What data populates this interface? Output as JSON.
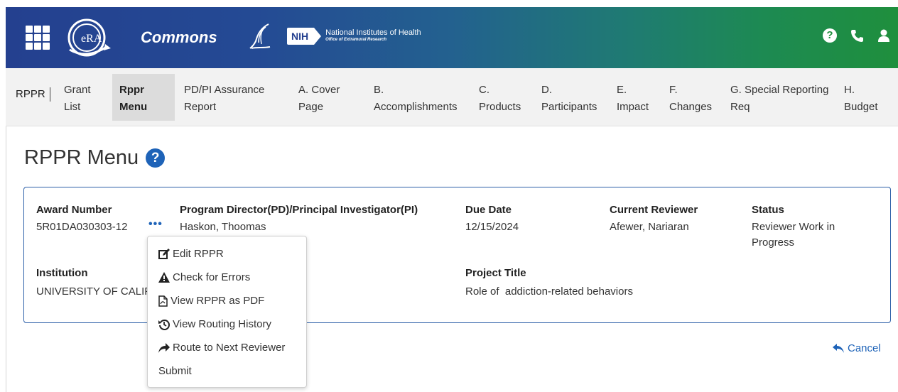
{
  "header": {
    "app_name": "Commons",
    "era_logo_text": "eRA",
    "nih_badge": "NIH",
    "nih_name": "National Institutes of Health",
    "nih_office": "Office of Extramural Research",
    "icons": [
      "apps-grid-icon",
      "help-icon",
      "phone-icon",
      "user-icon"
    ],
    "gradient_colors": [
      "#24408f",
      "#1f8f3d"
    ]
  },
  "nav": {
    "root": "RPPR",
    "items": [
      {
        "line1": "Grant",
        "line2": "List"
      },
      {
        "line1": "Rppr",
        "line2": "Menu",
        "active": true
      },
      {
        "line1": "PD/PI Assurance",
        "line2": "Report"
      },
      {
        "line1": "A. Cover",
        "line2": "Page"
      },
      {
        "line1": "B.",
        "line2": "Accomplishments"
      },
      {
        "line1": "C.",
        "line2": "Products"
      },
      {
        "line1": "D.",
        "line2": "Participants"
      },
      {
        "line1": "E.",
        "line2": "Impact"
      },
      {
        "line1": "F.",
        "line2": "Changes"
      },
      {
        "line1": "G. Special Reporting",
        "line2": "Req"
      },
      {
        "line1": "H.",
        "line2": "Budget"
      }
    ]
  },
  "page": {
    "title": "RPPR Menu",
    "help_glyph": "?"
  },
  "card": {
    "award_number_label": "Award Number",
    "award_number": "5R01DA030303-12",
    "actions_glyph": "•••",
    "pd_pi_label": "Program Director(PD)/Principal Investigator(PI)",
    "pd_pi": "Haskon, Thoomas",
    "due_date_label": "Due Date",
    "due_date": "12/15/2024",
    "reviewer_label": "Current Reviewer",
    "reviewer": "Afewer, Nariaran",
    "status_label": "Status",
    "status_line1": "Reviewer Work in",
    "status_line2": "Progress",
    "institution_label": "Institution",
    "institution": "UNIVERSITY OF CALIF",
    "project_title_label": "Project Title",
    "project_title": "Role of  addiction-related behaviors"
  },
  "menu": {
    "items": [
      {
        "label": "Edit RPPR",
        "icon": "edit-icon"
      },
      {
        "label": "Check for Errors",
        "icon": "warning-icon"
      },
      {
        "label": "View RPPR as PDF",
        "icon": "pdf-icon"
      },
      {
        "label": "View Routing History",
        "icon": "history-icon"
      },
      {
        "label": "Route to Next Reviewer",
        "icon": "share-icon"
      },
      {
        "label": "Submit",
        "icon": ""
      }
    ]
  },
  "actions": {
    "cancel": "Cancel"
  },
  "colors": {
    "accent_blue": "#1e63b8",
    "card_border": "#2c5fa8",
    "nav_active_bg": "#dcdcdc"
  }
}
